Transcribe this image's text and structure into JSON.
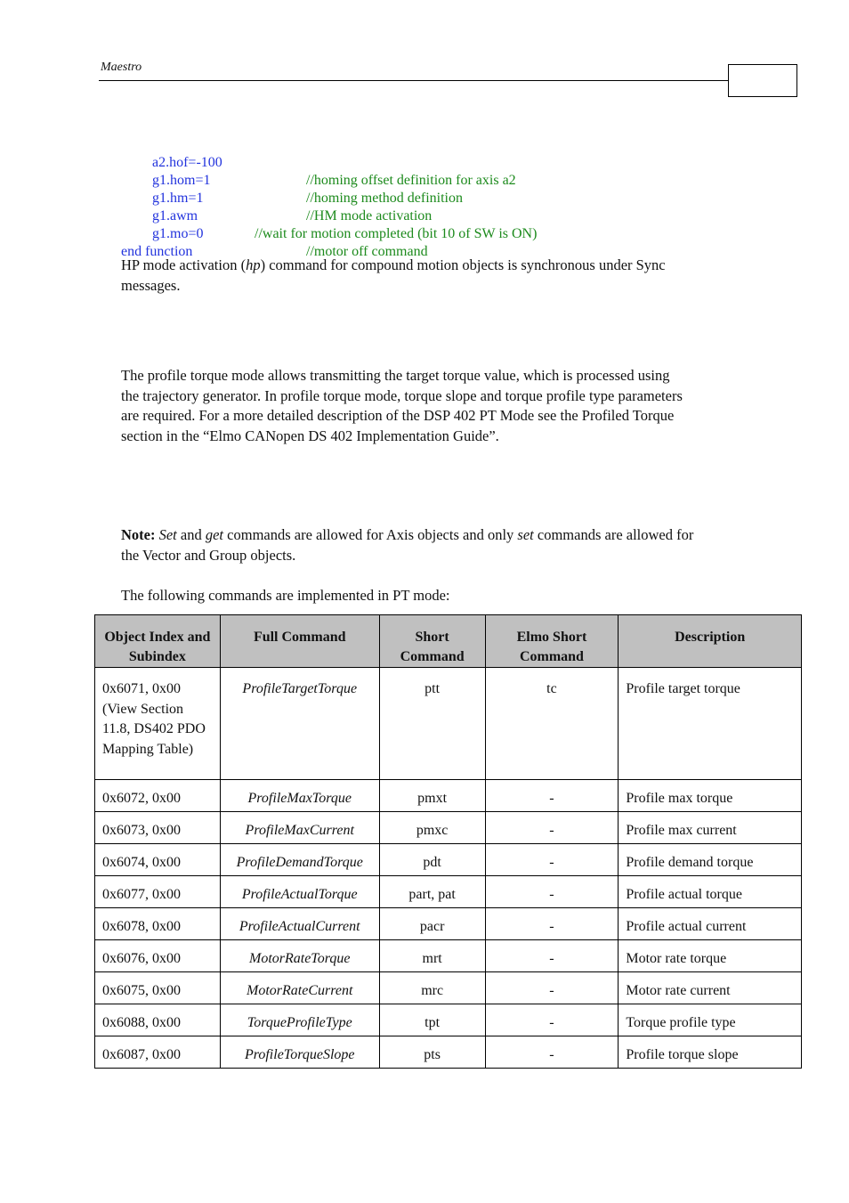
{
  "header": {
    "title": "Maestro",
    "page_number": ""
  },
  "code": {
    "lines": [
      {
        "cmd": "a2.hof=-100",
        "comment": "//homing offset definition for axis a2"
      },
      {
        "cmd": "g1.hom=1",
        "comment": "//homing method definition"
      },
      {
        "cmd": "g1.hm=1",
        "comment": "//HM mode activation"
      },
      {
        "cmd": "g1.awm",
        "comment": "//wait for motion completed (bit 10 of SW is ON)"
      },
      {
        "cmd": "g1.mo=0",
        "comment": "//motor off command"
      }
    ],
    "end": "end function"
  },
  "paragraphs": {
    "hp_mode": {
      "before": "HP mode activation (",
      "italic": "hp",
      "after": ") command for compound motion objects is synchronous under Sync messages."
    },
    "profile_torque": "The profile torque mode allows transmitting the target torque value, which is processed using the trajectory generator. In profile torque mode, torque slope and torque profile type parameters are required. For a more detailed description of the DSP 402 PT Mode see the Profiled Torque section in the “Elmo CANopen DS 402 Implementation Guide”.",
    "note": {
      "label": "Note:",
      "set1": "Set",
      "and": " and ",
      "get": "get",
      "mid": " commands are allowed for Axis objects and only ",
      "set2": "set",
      "end": " commands are allowed for the Vector and Group objects."
    },
    "intro": "The following commands are implemented in PT mode:"
  },
  "table": {
    "headers": [
      "Object Index and Subindex",
      "Full Command",
      "Short Command",
      "Elmo Short Command",
      "Description"
    ],
    "rows": [
      {
        "index": "0x6071, 0x00 (View Section 11.8, DS402 PDO Mapping Table)",
        "full": "ProfileTargetTorque",
        "short": "ptt",
        "elmo": "tc",
        "desc": "Profile target torque"
      },
      {
        "index": "0x6072, 0x00",
        "full": "ProfileMaxTorque",
        "short": "pmxt",
        "elmo": "-",
        "desc": "Profile max torque"
      },
      {
        "index": "0x6073, 0x00",
        "full": "ProfileMaxCurrent",
        "short": "pmxc",
        "elmo": "-",
        "desc": "Profile max current"
      },
      {
        "index": "0x6074, 0x00",
        "full": "ProfileDemandTorque",
        "short": "pdt",
        "elmo": "-",
        "desc": "Profile demand torque"
      },
      {
        "index": "0x6077, 0x00",
        "full": "ProfileActualTorque",
        "short": "part, pat",
        "elmo": "-",
        "desc": "Profile actual torque"
      },
      {
        "index": "0x6078, 0x00",
        "full": "ProfileActualCurrent",
        "short": "pacr",
        "elmo": "-",
        "desc": "Profile actual current"
      },
      {
        "index": "0x6076, 0x00",
        "full": "MotorRateTorque",
        "short": "mrt",
        "elmo": "-",
        "desc": "Motor rate torque"
      },
      {
        "index": "0x6075, 0x00",
        "full": "MotorRateCurrent",
        "short": "mrc",
        "elmo": "-",
        "desc": "Motor rate current"
      },
      {
        "index": "0x6088, 0x00",
        "full": "TorqueProfileType",
        "short": "tpt",
        "elmo": "-",
        "desc": "Torque profile type"
      },
      {
        "index": "0x6087, 0x00",
        "full": "ProfileTorqueSlope",
        "short": "pts",
        "elmo": "-",
        "desc": "Profile torque slope"
      }
    ]
  }
}
